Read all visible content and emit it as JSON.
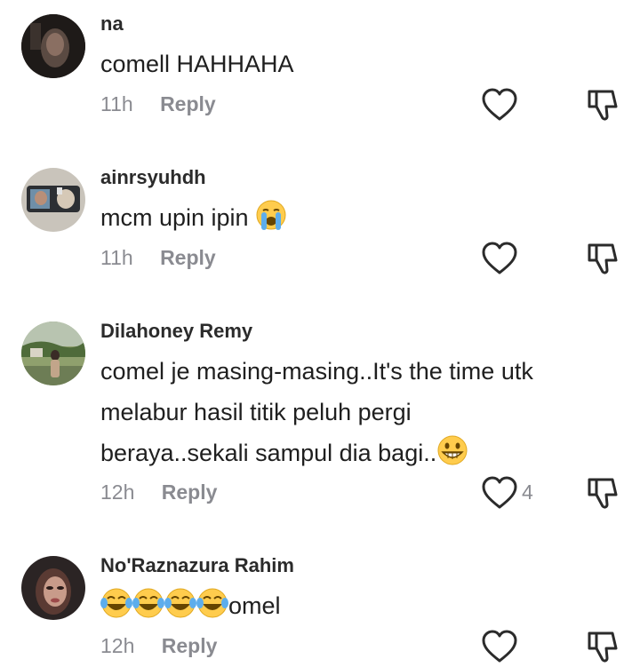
{
  "comments": [
    {
      "username": "na",
      "text": "comell HAHHAHA",
      "time": "11h",
      "reply": "Reply",
      "avatar_icon": "profile-photo-dark",
      "like_icon": "heart-outline-icon",
      "dislike_icon": "thumbs-down-outline-icon"
    },
    {
      "username": "ainrsyuhdh",
      "text": "mcm upin ipin",
      "emoji": [
        "loudly-crying-face-emoji"
      ],
      "time": "11h",
      "reply": "Reply",
      "avatar_icon": "profile-photo-mirror-selfie"
    },
    {
      "username": "Dilahoney Remy",
      "text_lines": [
        "comel je masing-masing..It's the time utk",
        "melabur hasil titik peluh pergi",
        "beraya..sekali sampul dia bagi.."
      ],
      "emoji": [
        "grinning-face-emoji"
      ],
      "time": "12h",
      "reply": "Reply",
      "likes": "4",
      "avatar_icon": "profile-photo-outdoor"
    },
    {
      "username": "No'Raznazura Rahim",
      "text": "omel",
      "emoji": [
        "tears-of-joy-emoji",
        "tears-of-joy-emoji",
        "tears-of-joy-emoji",
        "tears-of-joy-emoji"
      ],
      "time": "12h",
      "reply": "Reply",
      "avatar_icon": "profile-photo-woman"
    }
  ],
  "colors": {
    "text": "#161823",
    "muted": "#8a8b91",
    "background": "#ffffff"
  }
}
